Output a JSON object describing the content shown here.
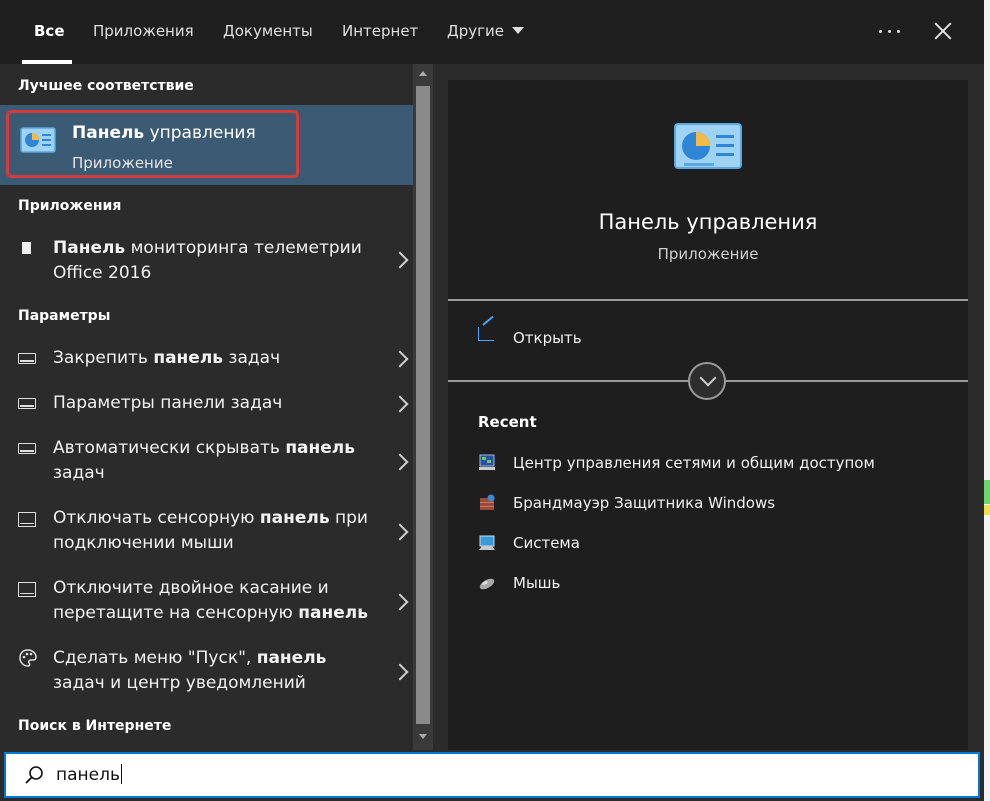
{
  "tabs": [
    {
      "label": "Все",
      "active": true
    },
    {
      "label": "Приложения"
    },
    {
      "label": "Документы"
    },
    {
      "label": "Интернет"
    },
    {
      "label": "Другие"
    }
  ],
  "topbar": {
    "more_icon": "ellipsis-icon",
    "close_icon": "close-icon"
  },
  "left": {
    "best_match_header": "Лучшее соответствие",
    "best_match": {
      "title_bold": "Панель",
      "title_rest": " управления",
      "subtitle": "Приложение",
      "icon": "control-panel-icon"
    },
    "apps_header": "Приложения",
    "apps": [
      {
        "bold": "Панель",
        "rest": " мониторинга телеметрии",
        "line2": "Office 2016",
        "icon": "document-icon"
      }
    ],
    "settings_header": "Параметры",
    "settings": [
      {
        "pre": "Закрепить ",
        "bold": "панель",
        "post": " задач",
        "line2": "",
        "icon": "taskbar-icon"
      },
      {
        "pre": "Параметры панели задач",
        "bold": "",
        "post": "",
        "line2": "",
        "icon": "taskbar-icon"
      },
      {
        "pre": "Автоматически скрывать ",
        "bold": "панель",
        "post": "",
        "line2": "задач",
        "icon": "taskbar-icon"
      },
      {
        "pre": "Отключать сенсорную ",
        "bold": "панель",
        "post": " при",
        "line2": "подключении мыши",
        "icon": "tablet-icon"
      },
      {
        "pre": "Отключите двойное касание и",
        "bold": "",
        "post": "",
        "line2_pre": "перетащите на сенсорную ",
        "line2_bold": "панель",
        "icon": "tablet-icon"
      },
      {
        "pre": "Сделать меню \"Пуск\", ",
        "bold": "панель",
        "post": "",
        "line2": "задач и центр уведомлений",
        "icon": "palette-icon"
      }
    ],
    "web_header": "Поиск в Интернете"
  },
  "detail": {
    "title": "Панель управления",
    "subtitle": "Приложение",
    "open_label": "Открыть",
    "recent_header": "Recent",
    "recent": [
      {
        "label": "Центр управления сетями и общим доступом",
        "icon": "network-icon"
      },
      {
        "label": "Брандмауэр Защитника Windows",
        "icon": "firewall-icon"
      },
      {
        "label": "Система",
        "icon": "system-icon"
      },
      {
        "label": "Мышь",
        "icon": "mouse-icon"
      }
    ]
  },
  "search": {
    "value": "панель",
    "icon": "search-icon"
  },
  "colors": {
    "accent": "#0078d4",
    "highlight": "#3b5a73",
    "outline_red": "#d63a3a"
  }
}
